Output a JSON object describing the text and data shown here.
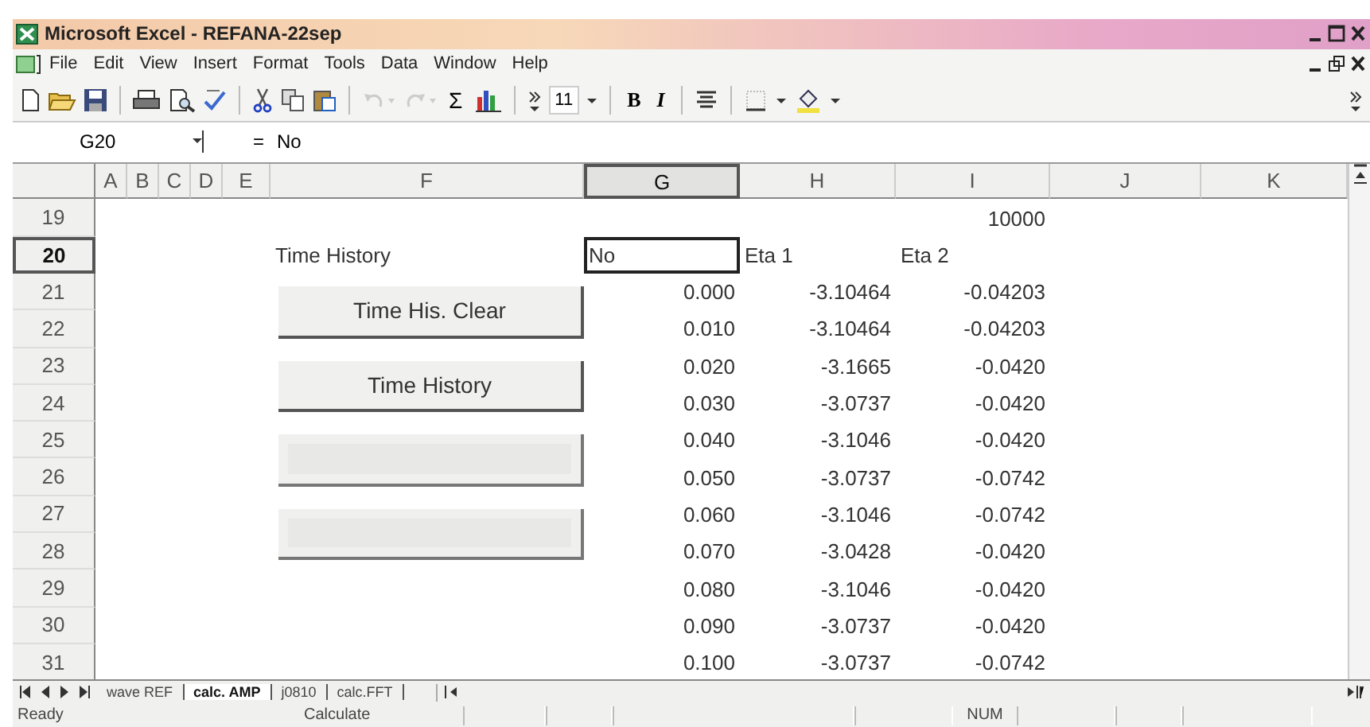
{
  "window": {
    "title": "Microsoft Excel - REFANA-22sep"
  },
  "menu": [
    "File",
    "Edit",
    "View",
    "Insert",
    "Format",
    "Tools",
    "Data",
    "Window",
    "Help"
  ],
  "toolbar": {
    "undo": {
      "disabled": true
    },
    "redo": {
      "disabled": true
    },
    "sum_label": "Σ",
    "font_size": "11",
    "bold_label": "B",
    "italic_label": "I"
  },
  "formula_bar": {
    "name_box": "G20",
    "equals": "=",
    "content": "No"
  },
  "sheet": {
    "columns": [
      {
        "label": "A",
        "selected": false
      },
      {
        "label": "B",
        "selected": false
      },
      {
        "label": "C",
        "selected": false
      },
      {
        "label": "D",
        "selected": false
      },
      {
        "label": "E",
        "selected": false
      },
      {
        "label": "F",
        "selected": false
      },
      {
        "label": "G",
        "selected": true
      },
      {
        "label": "H",
        "selected": false
      },
      {
        "label": "I",
        "selected": false
      },
      {
        "label": "J",
        "selected": false
      },
      {
        "label": "K",
        "selected": false
      }
    ],
    "rows": [
      {
        "number": "19",
        "selected": false,
        "i": "10000"
      },
      {
        "number": "20",
        "selected": true,
        "f": "Time History",
        "g": "No",
        "h": "Eta 1",
        "i": "Eta 2"
      },
      {
        "number": "21",
        "selected": false,
        "g": "0.000",
        "h": "-3.10464",
        "i": "-0.04203"
      },
      {
        "number": "22",
        "selected": false,
        "g": "0.010",
        "h": "-3.10464",
        "i": "-0.04203"
      },
      {
        "number": "23",
        "selected": false,
        "g": "0.020",
        "h": "-3.1665",
        "i": "-0.0420"
      },
      {
        "number": "24",
        "selected": false,
        "g": "0.030",
        "h": "-3.0737",
        "i": "-0.0420"
      },
      {
        "number": "25",
        "selected": false,
        "g": "0.040",
        "h": "-3.1046",
        "i": "-0.0420"
      },
      {
        "number": "26",
        "selected": false,
        "g": "0.050",
        "h": "-3.0737",
        "i": "-0.0742"
      },
      {
        "number": "27",
        "selected": false,
        "g": "0.060",
        "h": "-3.1046",
        "i": "-0.0742"
      },
      {
        "number": "28",
        "selected": false,
        "g": "0.070",
        "h": "-3.0428",
        "i": "-0.0420"
      },
      {
        "number": "29",
        "selected": false,
        "g": "0.080",
        "h": "-3.1046",
        "i": "-0.0420"
      },
      {
        "number": "30",
        "selected": false,
        "g": "0.090",
        "h": "-3.0737",
        "i": "-0.0420"
      },
      {
        "number": "31",
        "selected": false,
        "g": "0.100",
        "h": "-3.0737",
        "i": "-0.0742"
      }
    ],
    "buttons": [
      {
        "label": "Time His. Clear",
        "disabled": false
      },
      {
        "label": "Time History",
        "disabled": false
      },
      {
        "disabled": true
      },
      {
        "disabled": true
      }
    ]
  },
  "sheet_tabs": [
    {
      "label": "wave REF",
      "selected": false
    },
    {
      "label": "calc. AMP",
      "selected": true
    },
    {
      "label": "j0810",
      "selected": false
    },
    {
      "label": "calc.FFT",
      "selected": false
    }
  ],
  "status_bar": {
    "mode": "Ready",
    "message": "Calculate",
    "indicator": "NUM"
  }
}
